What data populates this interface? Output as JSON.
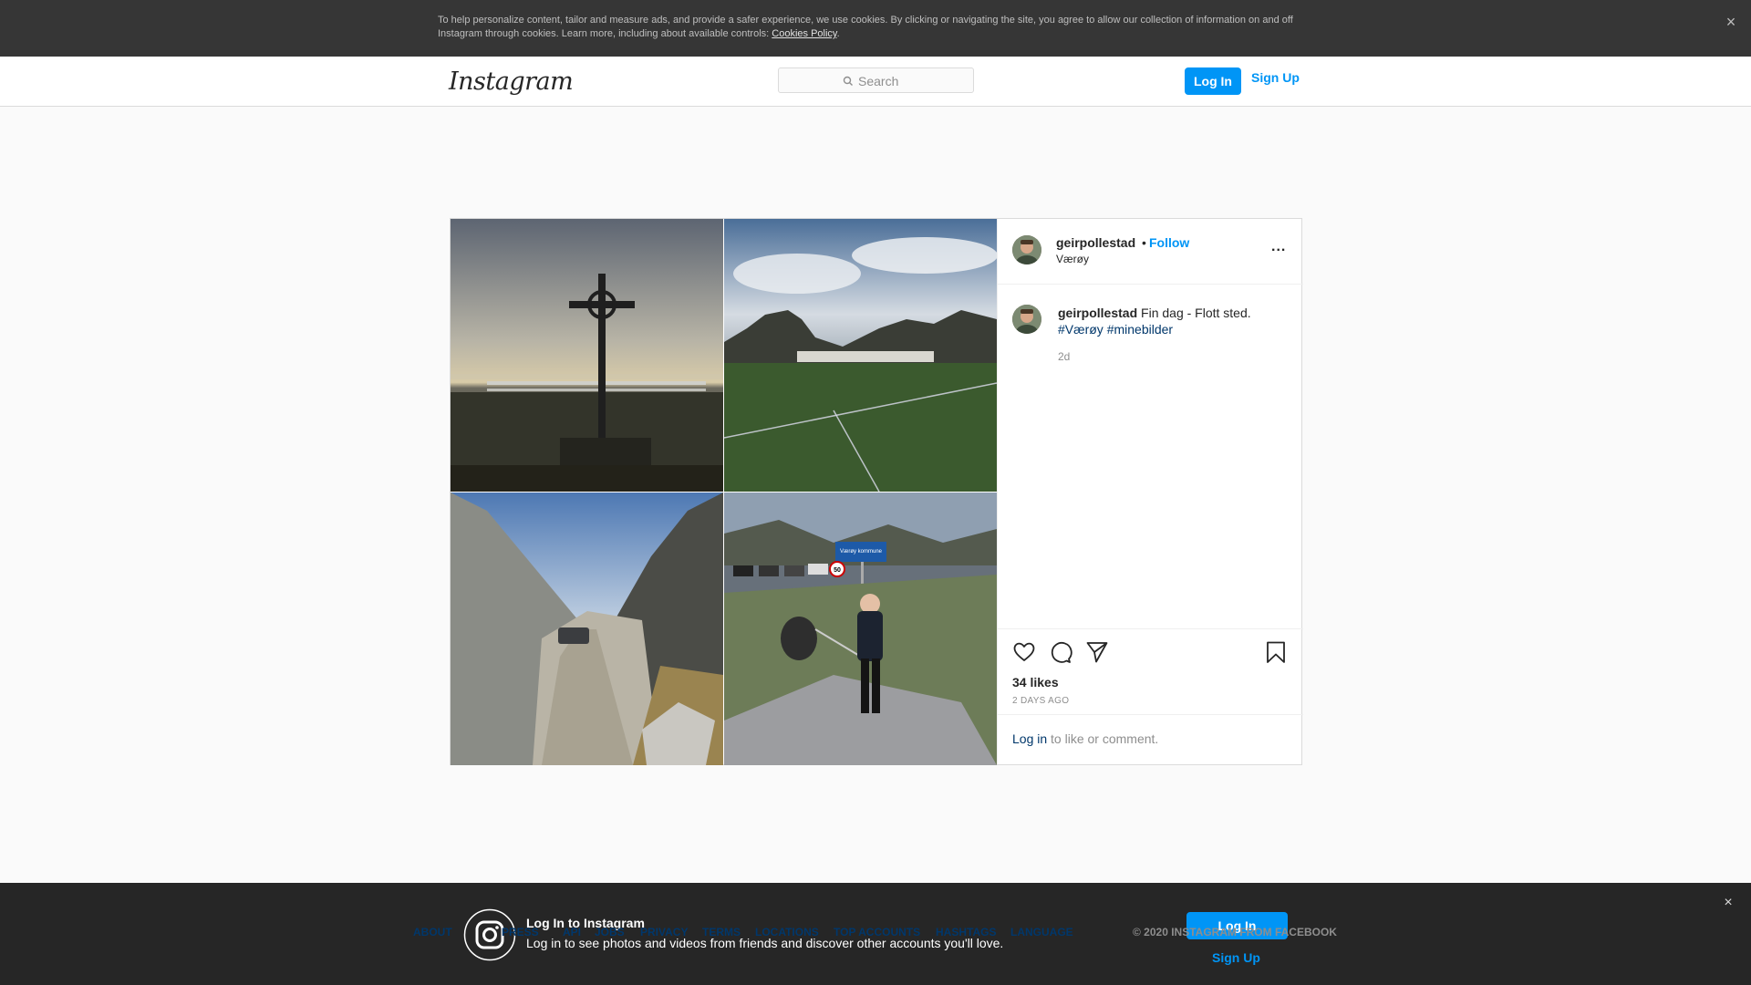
{
  "cookie_banner": {
    "text": "To help personalize content, tailor and measure ads, and provide a safer experience, we use cookies. By clicking or navigating the site, you agree to allow our collection of information on and off Instagram through cookies. Learn more, including about available controls: ",
    "link": "Cookies Policy",
    "suffix": ".",
    "close": "×"
  },
  "header": {
    "logo": "Instagram",
    "search_label": "Search",
    "login": "Log In",
    "signup": "Sign Up"
  },
  "post": {
    "username": "geirpollestad",
    "separator": "•",
    "follow": "Follow",
    "location": "Værøy",
    "more": "...",
    "caption_text": "Fin dag - Flott sted.",
    "tag1": "#Værøy",
    "tag2": "#minebilder",
    "caption_time": "2d",
    "likes": "34 likes",
    "posted_ago": "2 DAYS AGO",
    "login_link": "Log in",
    "comment_prompt": " to like or comment.",
    "sign_text": "Værøy kommune",
    "speed": "50"
  },
  "footer": {
    "links": [
      "ABOUT",
      "PRESS",
      "API",
      "JOBS",
      "PRIVACY",
      "TERMS",
      "LOCATIONS",
      "TOP ACCOUNTS",
      "HASHTAGS",
      "LANGUAGE"
    ],
    "copyright": "© 2020 INSTAGRAM FROM FACEBOOK"
  },
  "login_bar": {
    "title": "Log In to Instagram",
    "subtitle": "Log in to see photos and videos from friends and discover other accounts you'll love.",
    "login": "Log In",
    "signup": "Sign Up",
    "close": "×"
  },
  "colors": {
    "accent": "#0095f6",
    "dark_bar": "#262626",
    "cookie_bar": "#363636"
  }
}
